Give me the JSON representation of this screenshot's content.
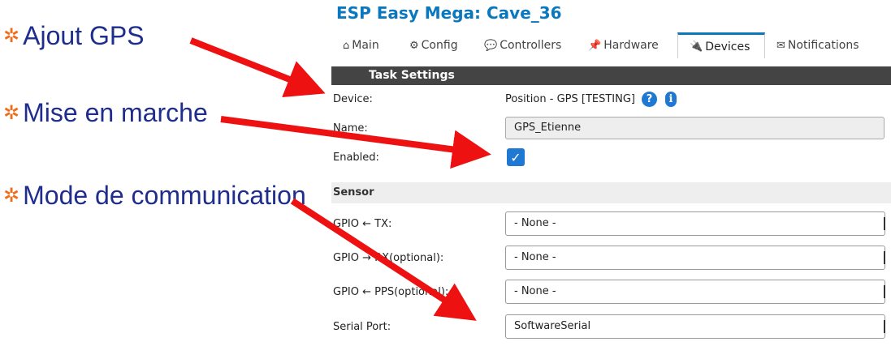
{
  "slide": {
    "bullets": [
      {
        "star": "✲",
        "text": "Ajout GPS"
      },
      {
        "star": "✲",
        "text": "Mise en marche"
      },
      {
        "star": "✲",
        "text": "Mode de communication"
      }
    ]
  },
  "app": {
    "title": "ESP Easy Mega: Cave_36",
    "tabs": [
      {
        "icon": "⌂",
        "label": "Main"
      },
      {
        "icon": "⚙",
        "label": "Config"
      },
      {
        "icon": "💬",
        "label": "Controllers"
      },
      {
        "icon": "📌",
        "label": "Hardware"
      },
      {
        "icon": "🔌",
        "label": "Devices"
      },
      {
        "icon": "✉",
        "label": "Notifications"
      }
    ],
    "active_tab": "Devices"
  },
  "task": {
    "section_title": "Task Settings",
    "device_label": "Device:",
    "device_value": "Position - GPS [TESTING]",
    "help_glyph": "?",
    "info_glyph": "i",
    "name_label": "Name:",
    "name_value": "GPS_Etienne",
    "enabled_label": "Enabled:",
    "enabled_check": "✓"
  },
  "sensor": {
    "section_title": "Sensor",
    "rows": [
      {
        "label": "GPIO ← TX:",
        "value": "- None -"
      },
      {
        "label": "GPIO → RX(optional):",
        "value": "- None -"
      },
      {
        "label": "GPIO ← PPS(optional):",
        "value": "- None -"
      },
      {
        "label": "Serial Port:",
        "value": "SoftwareSerial"
      }
    ]
  },
  "colors": {
    "bullet_text": "#1f2d8c",
    "bullet_star": "#ef6c1a",
    "title_blue": "#0a78be",
    "arrow_red": "#ee1111"
  }
}
